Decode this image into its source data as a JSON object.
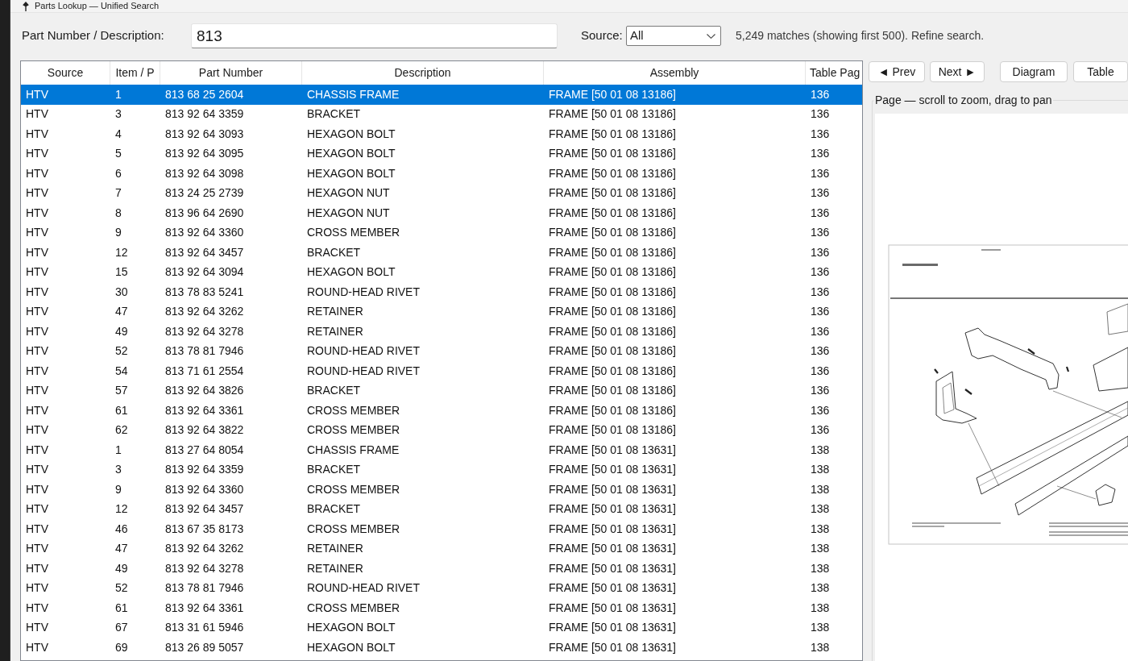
{
  "window": {
    "title": "Parts Lookup — Unified Search"
  },
  "search": {
    "label": "Part Number / Description:",
    "value": "813"
  },
  "source_filter": {
    "label": "Source:",
    "value": "All"
  },
  "status": "5,249 matches (showing first 500). Refine search.",
  "table": {
    "columns": [
      "Source",
      "Item / P",
      "Part Number",
      "Description",
      "Assembly",
      "Table Pag"
    ],
    "rows": [
      {
        "selected": true,
        "cells": [
          "HTV",
          "1",
          "813 68 25 2604",
          "CHASSIS FRAME",
          "FRAME [50 01 08 13186]",
          "136"
        ]
      },
      {
        "selected": false,
        "cells": [
          "HTV",
          "3",
          "813 92 64 3359",
          "BRACKET",
          "FRAME [50 01 08 13186]",
          "136"
        ]
      },
      {
        "selected": false,
        "cells": [
          "HTV",
          "4",
          "813 92 64 3093",
          "HEXAGON BOLT",
          "FRAME [50 01 08 13186]",
          "136"
        ]
      },
      {
        "selected": false,
        "cells": [
          "HTV",
          "5",
          "813 92 64 3095",
          "HEXAGON BOLT",
          "FRAME [50 01 08 13186]",
          "136"
        ]
      },
      {
        "selected": false,
        "cells": [
          "HTV",
          "6",
          "813 92 64 3098",
          "HEXAGON BOLT",
          "FRAME [50 01 08 13186]",
          "136"
        ]
      },
      {
        "selected": false,
        "cells": [
          "HTV",
          "7",
          "813 24 25 2739",
          "HEXAGON NUT",
          "FRAME [50 01 08 13186]",
          "136"
        ]
      },
      {
        "selected": false,
        "cells": [
          "HTV",
          "8",
          "813 96 64 2690",
          "HEXAGON NUT",
          "FRAME [50 01 08 13186]",
          "136"
        ]
      },
      {
        "selected": false,
        "cells": [
          "HTV",
          "9",
          "813 92 64 3360",
          "CROSS MEMBER",
          "FRAME [50 01 08 13186]",
          "136"
        ]
      },
      {
        "selected": false,
        "cells": [
          "HTV",
          "12",
          "813 92 64 3457",
          "BRACKET",
          "FRAME [50 01 08 13186]",
          "136"
        ]
      },
      {
        "selected": false,
        "cells": [
          "HTV",
          "15",
          "813 92 64 3094",
          "HEXAGON BOLT",
          "FRAME [50 01 08 13186]",
          "136"
        ]
      },
      {
        "selected": false,
        "cells": [
          "HTV",
          "30",
          "813 78 83 5241",
          "ROUND-HEAD RIVET",
          "FRAME [50 01 08 13186]",
          "136"
        ]
      },
      {
        "selected": false,
        "cells": [
          "HTV",
          "47",
          "813 92 64 3262",
          "RETAINER",
          "FRAME [50 01 08 13186]",
          "136"
        ]
      },
      {
        "selected": false,
        "cells": [
          "HTV",
          "49",
          "813 92 64 3278",
          "RETAINER",
          "FRAME [50 01 08 13186]",
          "136"
        ]
      },
      {
        "selected": false,
        "cells": [
          "HTV",
          "52",
          "813 78 81 7946",
          "ROUND-HEAD RIVET",
          "FRAME [50 01 08 13186]",
          "136"
        ]
      },
      {
        "selected": false,
        "cells": [
          "HTV",
          "54",
          "813 71 61 2554",
          "ROUND-HEAD RIVET",
          "FRAME [50 01 08 13186]",
          "136"
        ]
      },
      {
        "selected": false,
        "cells": [
          "HTV",
          "57",
          "813 92 64 3826",
          "BRACKET",
          "FRAME [50 01 08 13186]",
          "136"
        ]
      },
      {
        "selected": false,
        "cells": [
          "HTV",
          "61",
          "813 92 64 3361",
          "CROSS MEMBER",
          "FRAME [50 01 08 13186]",
          "136"
        ]
      },
      {
        "selected": false,
        "cells": [
          "HTV",
          "62",
          "813 92 64 3822",
          "CROSS MEMBER",
          "FRAME [50 01 08 13186]",
          "136"
        ]
      },
      {
        "selected": false,
        "cells": [
          "HTV",
          "1",
          "813 27 64 8054",
          "CHASSIS FRAME",
          "FRAME [50 01 08 13631]",
          "138"
        ]
      },
      {
        "selected": false,
        "cells": [
          "HTV",
          "3",
          "813 92 64 3359",
          "BRACKET",
          "FRAME [50 01 08 13631]",
          "138"
        ]
      },
      {
        "selected": false,
        "cells": [
          "HTV",
          "9",
          "813 92 64 3360",
          "CROSS MEMBER",
          "FRAME [50 01 08 13631]",
          "138"
        ]
      },
      {
        "selected": false,
        "cells": [
          "HTV",
          "12",
          "813 92 64 3457",
          "BRACKET",
          "FRAME [50 01 08 13631]",
          "138"
        ]
      },
      {
        "selected": false,
        "cells": [
          "HTV",
          "46",
          "813 67 35 8173",
          "CROSS MEMBER",
          "FRAME [50 01 08 13631]",
          "138"
        ]
      },
      {
        "selected": false,
        "cells": [
          "HTV",
          "47",
          "813 92 64 3262",
          "RETAINER",
          "FRAME [50 01 08 13631]",
          "138"
        ]
      },
      {
        "selected": false,
        "cells": [
          "HTV",
          "49",
          "813 92 64 3278",
          "RETAINER",
          "FRAME [50 01 08 13631]",
          "138"
        ]
      },
      {
        "selected": false,
        "cells": [
          "HTV",
          "52",
          "813 78 81 7946",
          "ROUND-HEAD RIVET",
          "FRAME [50 01 08 13631]",
          "138"
        ]
      },
      {
        "selected": false,
        "cells": [
          "HTV",
          "61",
          "813 92 64 3361",
          "CROSS MEMBER",
          "FRAME [50 01 08 13631]",
          "138"
        ]
      },
      {
        "selected": false,
        "cells": [
          "HTV",
          "67",
          "813 31 61 5946",
          "HEXAGON BOLT",
          "FRAME [50 01 08 13631]",
          "138"
        ]
      },
      {
        "selected": false,
        "cells": [
          "HTV",
          "69",
          "813 26 89 5057",
          "HEXAGON BOLT",
          "FRAME [50 01 08 13631]",
          "138"
        ]
      }
    ]
  },
  "navigation_buttons": [
    "◄ Prev",
    "Next ►"
  ],
  "view_buttons": [
    "Diagram",
    "Table"
  ],
  "page_viewer": {
    "title": "Page — scroll to zoom, drag to pan"
  }
}
